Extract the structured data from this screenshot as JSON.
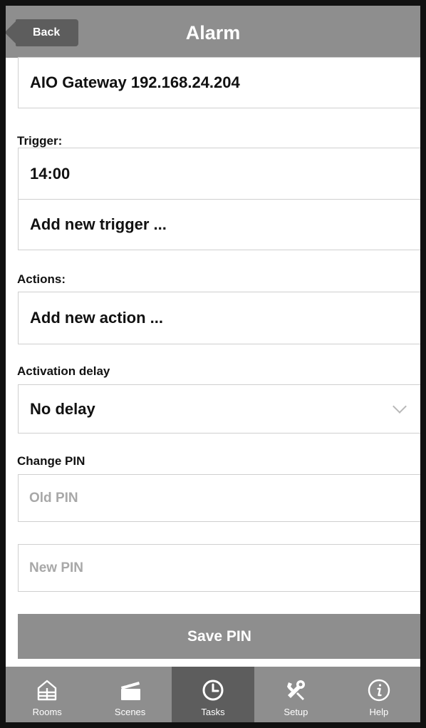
{
  "header": {
    "back_label": "Back",
    "title": "Alarm"
  },
  "gateway": {
    "value": "AIO Gateway 192.168.24.204"
  },
  "trigger": {
    "label": "Trigger:",
    "items": [
      "14:00"
    ],
    "add_label": "Add new trigger ..."
  },
  "actions": {
    "label": "Actions:",
    "add_label": "Add new action ..."
  },
  "activation_delay": {
    "label": "Activation delay",
    "selected": "No delay"
  },
  "change_pin": {
    "label": "Change PIN",
    "old_placeholder": "Old PIN",
    "new_placeholder": "New PIN",
    "save_label": "Save PIN"
  },
  "tabbar": {
    "tabs": [
      {
        "label": "Rooms",
        "icon": "rooms-icon"
      },
      {
        "label": "Scenes",
        "icon": "scenes-icon"
      },
      {
        "label": "Tasks",
        "icon": "clock-icon"
      },
      {
        "label": "Setup",
        "icon": "setup-icon"
      },
      {
        "label": "Help",
        "icon": "info-icon"
      }
    ],
    "active": "Tasks"
  },
  "colors": {
    "bar": "#8e8e8e",
    "active": "#5d5d5d",
    "border": "#cfcfcf",
    "placeholder": "#a8a8a8"
  }
}
